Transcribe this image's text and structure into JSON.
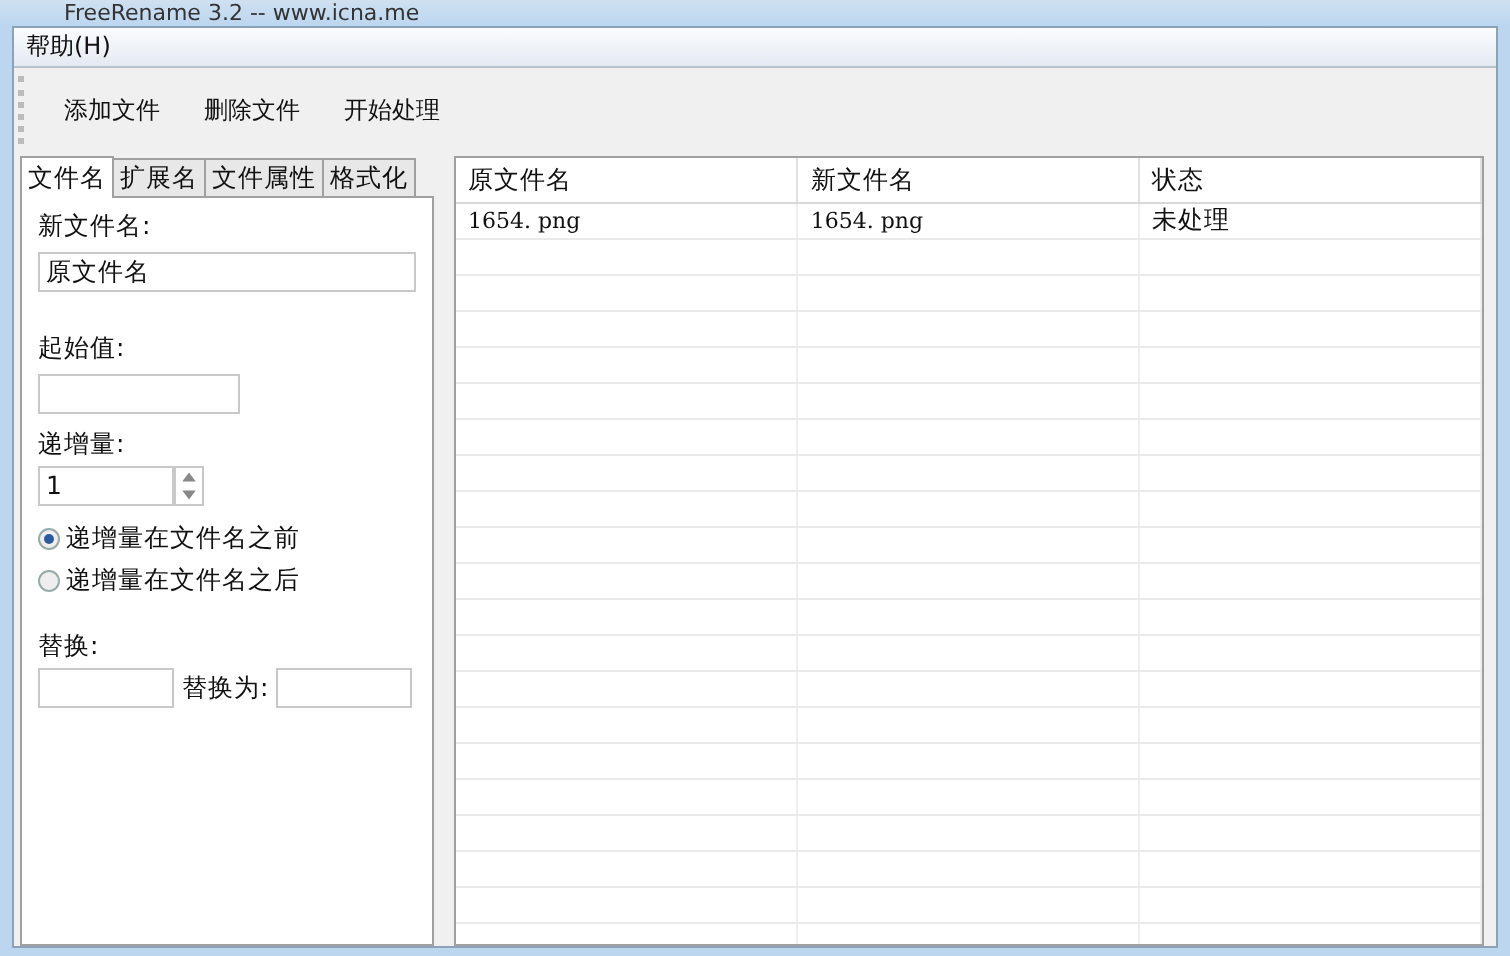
{
  "window": {
    "title": "FreeRename 3.2  --  www.icna.me"
  },
  "menu": [
    {
      "label": "帮助(H)"
    }
  ],
  "toolbar": [
    {
      "label": "添加文件"
    },
    {
      "label": "删除文件"
    },
    {
      "label": "开始处理"
    }
  ],
  "tabs": [
    {
      "label": "文件名",
      "selected": true
    },
    {
      "label": "扩展名",
      "selected": false
    },
    {
      "label": "文件属性",
      "selected": false
    },
    {
      "label": "格式化",
      "selected": false
    }
  ],
  "form": {
    "new_name_label": "新文件名:",
    "new_name_value": "原文件名",
    "start_label": "起始值:",
    "step_label": "递增量:",
    "step_value": "1",
    "position_options": [
      {
        "label": "递增量在文件名之前",
        "selected": true
      },
      {
        "label": "递增量在文件名之后",
        "selected": false
      }
    ],
    "replace_label": "替换:",
    "replace_with_label": "替换为:"
  },
  "table": {
    "columns": [
      "原文件名",
      "新文件名",
      "状态"
    ],
    "rows": [
      [
        "1654. png",
        "1654. png",
        "未处理"
      ]
    ]
  }
}
